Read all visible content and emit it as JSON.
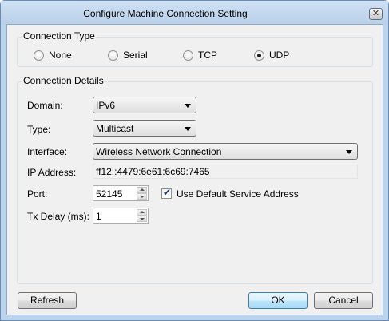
{
  "window": {
    "title": "Configure Machine Connection Setting",
    "close_glyph": "✕"
  },
  "connection_type": {
    "legend": "Connection Type",
    "options": [
      "None",
      "Serial",
      "TCP",
      "UDP"
    ],
    "selected": "UDP"
  },
  "details": {
    "legend": "Connection Details",
    "domain": {
      "label": "Domain:",
      "value": "IPv6"
    },
    "type": {
      "label": "Type:",
      "value": "Multicast"
    },
    "interface": {
      "label": "Interface:",
      "value": "Wireless Network Connection"
    },
    "ip_address": {
      "label": "IP Address:",
      "value": "ff12::4479:6e61:6c69:7465"
    },
    "port": {
      "label": "Port:",
      "value": "52145"
    },
    "use_default": {
      "label": "Use Default Service Address",
      "checked": true
    },
    "tx_delay": {
      "label": "Tx Delay (ms):",
      "value": "1"
    }
  },
  "buttons": {
    "refresh": "Refresh",
    "ok": "OK",
    "cancel": "Cancel"
  }
}
